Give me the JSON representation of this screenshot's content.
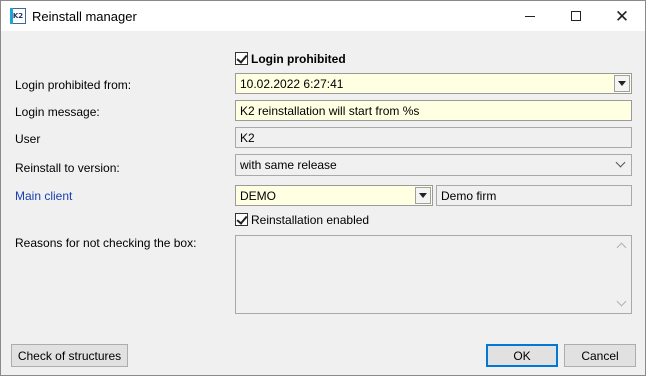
{
  "window": {
    "icon_text": "K2",
    "title": "Reinstall manager",
    "icons": {
      "minimize": "minimize-icon",
      "maximize": "maximize-icon",
      "close": "close-icon"
    }
  },
  "form": {
    "login_prohibited": {
      "label": "Login prohibited",
      "checked": true
    },
    "login_prohibited_from": {
      "label": "Login prohibited from:",
      "value": "10.02.2022  6:27:41"
    },
    "login_message": {
      "label": "Login message:",
      "value": "K2 reinstallation will start from %s"
    },
    "user": {
      "label": "User",
      "value": "K2"
    },
    "reinstall_version": {
      "label": "Reinstall to version:",
      "value": "with same release"
    },
    "main_client": {
      "label": "Main client",
      "value": "DEMO",
      "description": "Demo firm"
    },
    "reinstallation_enabled": {
      "label": "Reinstallation enabled",
      "checked": true
    },
    "reasons": {
      "label": "Reasons for not checking the box:",
      "value": ""
    }
  },
  "buttons": {
    "check_structures": "Check of structures",
    "ok": "OK",
    "cancel": "Cancel"
  },
  "colors": {
    "editable_bg": "#ffffe1",
    "readonly_bg": "#f0f0f0",
    "link": "#1a3fb0",
    "default_button_border": "#0078d7"
  }
}
